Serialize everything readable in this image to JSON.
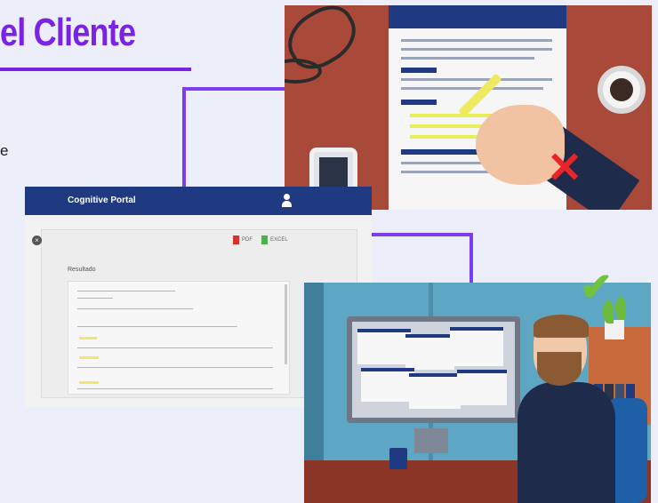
{
  "heading": {
    "title": "el Cliente",
    "stray_text": "e"
  },
  "portal": {
    "app_title": "Cognitive Portal",
    "buttons": {
      "pdf_label": "PDF",
      "excel_label": "EXCEL"
    },
    "results_label": "Resultado"
  },
  "colors": {
    "accent": "#7a22e6",
    "connector": "#7b3df0",
    "portal_header": "#1f3a80",
    "reject_mark": "#e8262a",
    "approve_mark": "#72c23d"
  },
  "icons": {
    "user": "user-icon",
    "close": "close-icon",
    "pdf": "pdf-file-icon",
    "excel": "excel-file-icon",
    "reject": "x-mark-icon",
    "approve": "check-mark-icon"
  }
}
